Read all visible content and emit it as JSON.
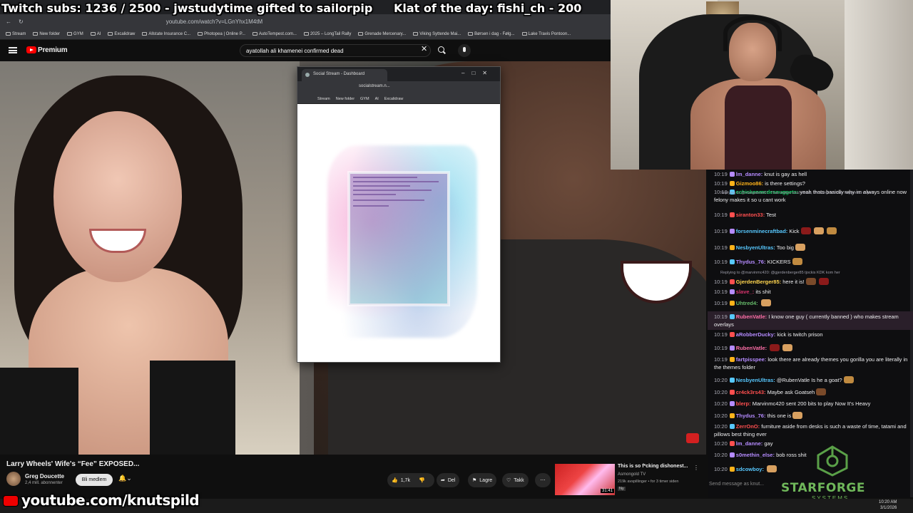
{
  "overlay": {
    "subs": "Twitch subs: 1236 / 2500 - jwstudytime gifted to sailorpip",
    "klat": "Klat of the day: fishi_ch - 200",
    "youtube_handle": "youtube.com/knutspild"
  },
  "browser": {
    "url": "youtube.com/watch?v=LGnYhx1M4tM",
    "bookmarks": [
      "Stream",
      "New folder",
      "GYM",
      "AI",
      "Excalidraw",
      "Allstate Insurance C...",
      "Photopea | Online P...",
      "AutoTempest.com...",
      "2025 – LongTail Rally",
      "Grenade Mercenary...",
      "Viking Syttende Mai...",
      "Børsen i dag - Følg...",
      "Lake Travis Pontoon..."
    ]
  },
  "youtube": {
    "brand": "Premium",
    "search_query": "ayatollah ali khamenei confirmed dead",
    "video_title": "Larry Wheels' Wife's “Fee” EXPOSED...",
    "channel_name": "Greg Doucette",
    "channel_subs": "2,4 mill. abonnenter",
    "join_label": "Bli medlem",
    "like_count": "1,7k",
    "share_label": "Del",
    "save_label": "Lagre",
    "thanks_label": "Takk",
    "suggestion": {
      "title": "This is so f*cking dishonest...",
      "channel": "Asmongold TV",
      "meta": "219k avspillinger • for 3 timer siden",
      "duration": "31:41",
      "badge": "Ny"
    }
  },
  "popup": {
    "tab_title": "Social Stream - Dashboard",
    "url": "socialstream.n...",
    "bookmarks": [
      "Stream",
      "New folder",
      "GYM",
      "AI",
      "Excalidraw"
    ]
  },
  "chat": {
    "messages": [
      {
        "time": "10:19",
        "user": "lm_danne:",
        "color": "#b58bff",
        "text": "knut is gay as hell"
      },
      {
        "time": "10:19",
        "user": "Gizmoo86:",
        "color": "#ffb31a",
        "text": "is there settings?"
      },
      {
        "time": "10:19",
        "user": "cchickenmcdesnuggets:",
        "color": "#00c853",
        "text": "yeah thats basiclly why im always online now felony makes it so u cant work"
      },
      {
        "time": "10:19",
        "user": "siranton33:",
        "color": "#ff4f4f",
        "text": "Test"
      },
      {
        "time": "10:19",
        "user": "forsenminecraftbad:",
        "color": "#57c8ff",
        "text": "Kick"
      },
      {
        "time": "10:19",
        "user": "NesbyenUltras:",
        "color": "#57c8ff",
        "text": "Too big"
      },
      {
        "time": "10:19",
        "user": "Thydus_76:",
        "color": "#b58bff",
        "text": "KICKERS"
      },
      {
        "time": "10:19",
        "user": "GjerdenBerger85:",
        "color": "#ffd54f",
        "text": "here it is!"
      },
      {
        "time": "10:19",
        "user": "slave_:",
        "color": "#d6336c",
        "text": "its shit"
      },
      {
        "time": "10:19",
        "user": "Uhtred4:",
        "color": "#66bb6a",
        "text": ""
      },
      {
        "time": "10:19",
        "user": "RubenVatle:",
        "color": "#ff6fa8",
        "text": "I know one guy ( currently banned ) who makes stream overlays"
      },
      {
        "time": "10:19",
        "user": "aRobberDucky:",
        "color": "#b58bff",
        "text": "kick is twitch prison"
      },
      {
        "time": "10:19",
        "user": "RubenVatle:",
        "color": "#ff6fa8",
        "text": ""
      },
      {
        "time": "10:19",
        "user": "fartpisspee:",
        "color": "#b58bff",
        "text": "look there are already themes you gorilla you are literally in the themes folder"
      },
      {
        "time": "10:20",
        "user": "NesbyenUltras:",
        "color": "#57c8ff",
        "text": "@RubenVatle Is he a goat?"
      },
      {
        "time": "10:20",
        "user": "cr4ck3rs43:",
        "color": "#ff4f4f",
        "text": "Maybe ask Goatseh"
      },
      {
        "time": "10:20",
        "user": "blerp:",
        "color": "#ff4f4f",
        "text": "Marvinmc420 sent 200 bits to play Now It's Heavy"
      },
      {
        "time": "10:20",
        "user": "Thydus_76:",
        "color": "#b58bff",
        "text": "this one is"
      },
      {
        "time": "10:20",
        "user": "ZerrOnO:",
        "color": "#ff4f4f",
        "text": "furniture aside from desks is such a waste of time, tatami and pillows best thing ever"
      },
      {
        "time": "10:20",
        "user": "lm_danne:",
        "color": "#b58bff",
        "text": "gay"
      },
      {
        "time": "10:20",
        "user": "s0methin_else:",
        "color": "#b58bff",
        "text": "bob ross shit"
      },
      {
        "time": "10:20",
        "user": "sdcowboy:",
        "color": "#57c8ff",
        "text": ""
      }
    ],
    "reply_1": "Replying to @vladgabriel67: That makes total sense, I'm sorry that this happened to you",
    "reply_2": "Replying to @marvinmc420: @gjerdenberger85 tjockis KDK kom her",
    "input_placeholder": "Send message as knut...",
    "sponsor": "STARFORGE",
    "sponsor_sub": "SYSTEMS"
  },
  "taskbar": {
    "time": "10:20 AM",
    "date": "3/1/2026"
  }
}
